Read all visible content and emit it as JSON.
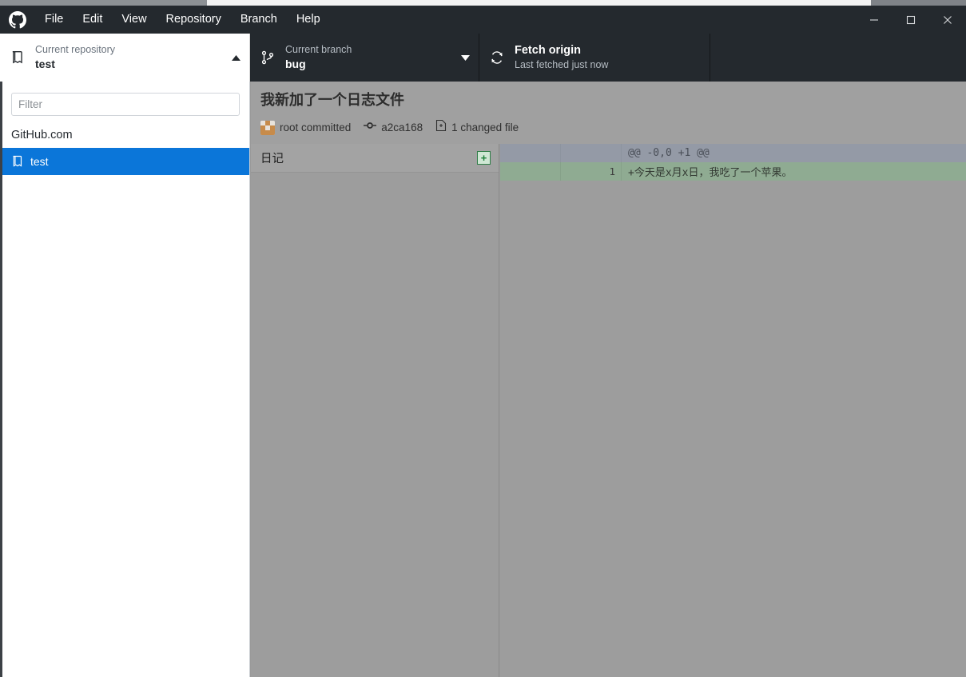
{
  "window": {
    "app_logo": "github-logo",
    "menu": [
      {
        "label": "File"
      },
      {
        "label": "Edit"
      },
      {
        "label": "View"
      },
      {
        "label": "Repository"
      },
      {
        "label": "Branch"
      },
      {
        "label": "Help"
      }
    ],
    "controls": {
      "minimize": "minimize-icon",
      "maximize": "maximize-icon",
      "close": "close-icon"
    }
  },
  "toolbar": {
    "repository": {
      "icon": "repository-book-icon",
      "label": "Current repository",
      "value": "test",
      "chevron": "chevron-up-icon"
    },
    "branch": {
      "icon": "branch-icon",
      "label": "Current branch",
      "value": "bug",
      "chevron": "chevron-down-icon"
    },
    "fetch": {
      "icon": "sync-refresh-icon",
      "label": "Fetch origin",
      "value": "Last fetched just now"
    }
  },
  "repo_panel": {
    "filter_placeholder": "Filter",
    "filter_value": "",
    "group_header": "GitHub.com",
    "items": [
      {
        "name": "test",
        "icon": "repository-book-icon",
        "selected": true
      }
    ]
  },
  "commit": {
    "title": "我新加了一个日志文件",
    "author": "root committed",
    "sha_icon": "commit-dot-icon",
    "sha": "a2ca168",
    "files_icon": "file-diff-icon",
    "files_changed": "1 changed file"
  },
  "file_list": [
    {
      "name": "日记",
      "status": "added",
      "status_symbol": "+"
    }
  ],
  "diff": {
    "rows": [
      {
        "type": "hunk",
        "old_line": "",
        "new_line": "",
        "text": "@@ -0,0 +1 @@"
      },
      {
        "type": "add",
        "old_line": "",
        "new_line": "1",
        "text": "+今天是x月x日，我吃了一个苹果。"
      }
    ]
  },
  "colors": {
    "titlebar_bg": "#24292e",
    "selection_blue": "#0b76d9",
    "diff_add_bg": "#8fab92",
    "diff_hunk_bg": "#949aa6",
    "added_badge": "#1a7f37"
  }
}
